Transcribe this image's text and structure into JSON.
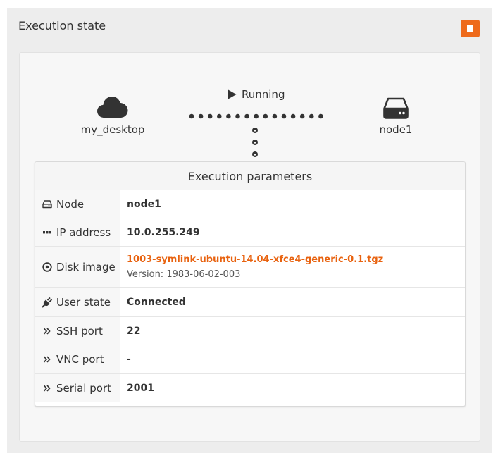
{
  "panel": {
    "title": "Execution state",
    "stop_icon": "stop-icon",
    "accent_color": "#ee6a1b"
  },
  "diagram": {
    "source": {
      "label": "my_desktop",
      "icon": "cloud-icon"
    },
    "target": {
      "label": "node1",
      "icon": "hard-drive-icon"
    },
    "status": {
      "label": "Running",
      "icon": "play-icon"
    }
  },
  "params": {
    "title": "Execution parameters",
    "rows": [
      {
        "key": "Node",
        "icon": "hard-drive-icon",
        "value": "node1"
      },
      {
        "key": "IP address",
        "icon": "ellipsis-icon",
        "value": "10.0.255.249"
      },
      {
        "key": "Disk image",
        "icon": "disc-icon",
        "value": "1003-symlink-ubuntu-14.04-xfce4-generic-0.1.tgz",
        "sub": "Version: 1983-06-02-003"
      },
      {
        "key": "User state",
        "icon": "plug-icon",
        "value": "Connected"
      },
      {
        "key": "SSH port",
        "icon": "double-chevron-right-icon",
        "value": "22"
      },
      {
        "key": "VNC port",
        "icon": "double-chevron-right-icon",
        "value": "-"
      },
      {
        "key": "Serial port",
        "icon": "double-chevron-right-icon",
        "value": "2001"
      }
    ]
  }
}
